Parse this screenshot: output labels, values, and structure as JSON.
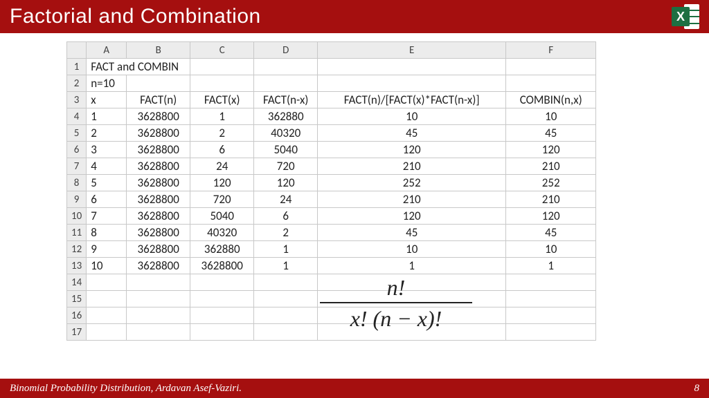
{
  "title": "Factorial and Combination",
  "footer": {
    "left": "Binomial Probability Distribution, Ardavan Asef-Vaziri.",
    "right": "8"
  },
  "excel_badge": "X",
  "columns": [
    "A",
    "B",
    "C",
    "D",
    "E",
    "F"
  ],
  "row_labels": [
    "1",
    "2",
    "3",
    "4",
    "5",
    "6",
    "7",
    "8",
    "9",
    "10",
    "11",
    "12",
    "13",
    "14",
    "15",
    "16",
    "17"
  ],
  "cells": {
    "r1": {
      "A": "FACT and COMBIN"
    },
    "r2": {
      "A": "n=10"
    },
    "r3": {
      "A": "x",
      "B": "FACT(n)",
      "C": "FACT(x)",
      "D": "FACT(n-x)",
      "E": "FACT(n)/[FACT(x)*FACT(n-x)]",
      "F": "COMBIN(n,x)"
    }
  },
  "data_rows": [
    {
      "x": "1",
      "fn": "3628800",
      "fx": "1",
      "fnx": "362880",
      "ratio": "10",
      "comb": "10"
    },
    {
      "x": "2",
      "fn": "3628800",
      "fx": "2",
      "fnx": "40320",
      "ratio": "45",
      "comb": "45"
    },
    {
      "x": "3",
      "fn": "3628800",
      "fx": "6",
      "fnx": "5040",
      "ratio": "120",
      "comb": "120"
    },
    {
      "x": "4",
      "fn": "3628800",
      "fx": "24",
      "fnx": "720",
      "ratio": "210",
      "comb": "210"
    },
    {
      "x": "5",
      "fn": "3628800",
      "fx": "120",
      "fnx": "120",
      "ratio": "252",
      "comb": "252"
    },
    {
      "x": "6",
      "fn": "3628800",
      "fx": "720",
      "fnx": "24",
      "ratio": "210",
      "comb": "210"
    },
    {
      "x": "7",
      "fn": "3628800",
      "fx": "5040",
      "fnx": "6",
      "ratio": "120",
      "comb": "120"
    },
    {
      "x": "8",
      "fn": "3628800",
      "fx": "40320",
      "fnx": "2",
      "ratio": "45",
      "comb": "45"
    },
    {
      "x": "9",
      "fn": "3628800",
      "fx": "362880",
      "fnx": "1",
      "ratio": "10",
      "comb": "10"
    },
    {
      "x": "10",
      "fn": "3628800",
      "fx": "3628800",
      "fnx": "1",
      "ratio": "1",
      "comb": "1"
    }
  ],
  "formula": {
    "numerator": "n!",
    "denominator": "x! (n − x)!"
  },
  "chart_data": {
    "type": "table",
    "title": "FACT and COMBIN, n=10",
    "columns": [
      "x",
      "FACT(n)",
      "FACT(x)",
      "FACT(n-x)",
      "FACT(n)/[FACT(x)*FACT(n-x)]",
      "COMBIN(n,x)"
    ],
    "rows": [
      [
        1,
        3628800,
        1,
        362880,
        10,
        10
      ],
      [
        2,
        3628800,
        2,
        40320,
        45,
        45
      ],
      [
        3,
        3628800,
        6,
        5040,
        120,
        120
      ],
      [
        4,
        3628800,
        24,
        720,
        210,
        210
      ],
      [
        5,
        3628800,
        120,
        120,
        252,
        252
      ],
      [
        6,
        3628800,
        720,
        24,
        210,
        210
      ],
      [
        7,
        3628800,
        5040,
        6,
        120,
        120
      ],
      [
        8,
        3628800,
        40320,
        2,
        45,
        45
      ],
      [
        9,
        3628800,
        362880,
        1,
        10,
        10
      ],
      [
        10,
        3628800,
        3628800,
        1,
        1,
        1
      ]
    ]
  }
}
